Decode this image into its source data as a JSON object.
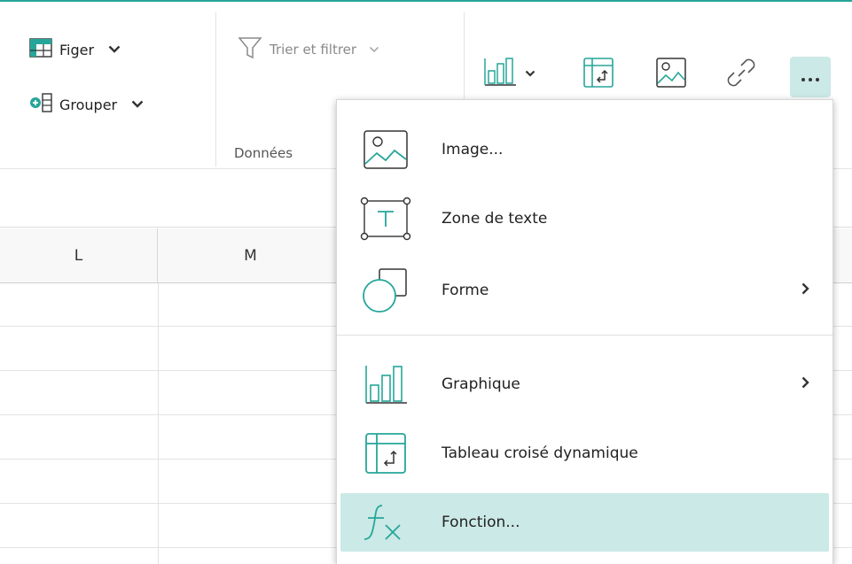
{
  "ribbon": {
    "freeze_label": "Figer",
    "group_label": "Grouper",
    "sort_filter_label": "Trier et filtrer",
    "data_group_label": "Données"
  },
  "columns": [
    "L",
    "M"
  ],
  "menu": {
    "items": [
      {
        "label": "Image...",
        "icon": "image-icon",
        "has_submenu": false
      },
      {
        "label": "Zone de texte",
        "icon": "text-box-icon",
        "has_submenu": false
      },
      {
        "label": "Forme",
        "icon": "shape-icon",
        "has_submenu": true
      },
      {
        "label": "Graphique",
        "icon": "chart-icon",
        "has_submenu": true
      },
      {
        "label": "Tableau croisé dynamique",
        "icon": "pivot-table-icon",
        "has_submenu": false
      },
      {
        "label": "Fonction...",
        "icon": "function-icon",
        "has_submenu": false,
        "highlighted": true
      }
    ]
  },
  "colors": {
    "accent": "#26a69a",
    "highlight": "#cbe9e6"
  }
}
